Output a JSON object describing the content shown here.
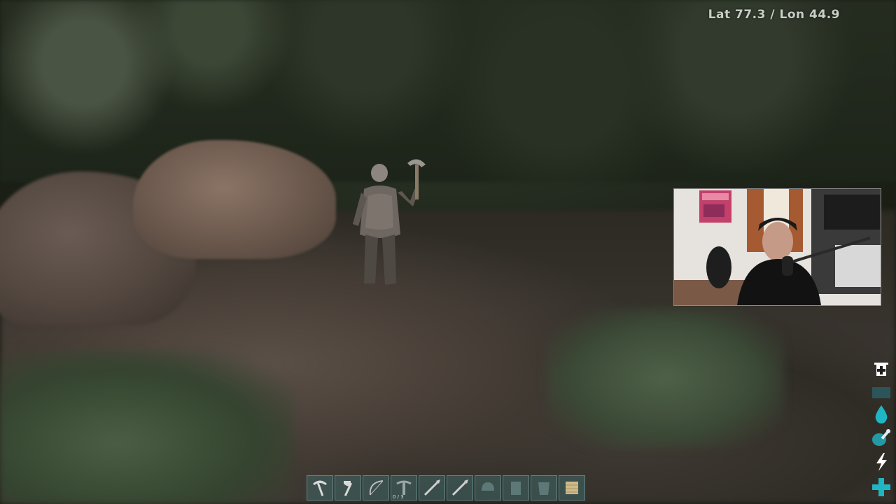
{
  "hud": {
    "coordinates": "Lat 77.3 / Lon 44.9"
  },
  "status_icons": [
    {
      "name": "level-up-icon"
    },
    {
      "name": "weight-icon"
    },
    {
      "name": "water-drop-icon"
    },
    {
      "name": "food-icon"
    },
    {
      "name": "stamina-bolt-icon"
    },
    {
      "name": "health-plus-icon"
    }
  ],
  "hotbar": {
    "slots": [
      {
        "item": "pickaxe-icon",
        "count": "",
        "durability": ""
      },
      {
        "item": "hatchet-icon",
        "count": "",
        "durability": ""
      },
      {
        "item": "bow-icon",
        "count": "",
        "durability": ""
      },
      {
        "item": "crossbow-icon",
        "count": "",
        "durability": "0 / 3"
      },
      {
        "item": "spear-icon",
        "count": "",
        "durability": ""
      },
      {
        "item": "spear-icon-2",
        "count": "",
        "durability": ""
      },
      {
        "item": "helmet-icon",
        "count": "",
        "durability": ""
      },
      {
        "item": "armor-icon",
        "count": "",
        "durability": ""
      },
      {
        "item": "cloth-icon",
        "count": "",
        "durability": ""
      },
      {
        "item": "thatch-icon",
        "count": "",
        "durability": ""
      }
    ]
  },
  "colors": {
    "hud_accent": "#1fb6c4",
    "hud_text": "#c9cdc6",
    "slot_bg": "#406868"
  }
}
